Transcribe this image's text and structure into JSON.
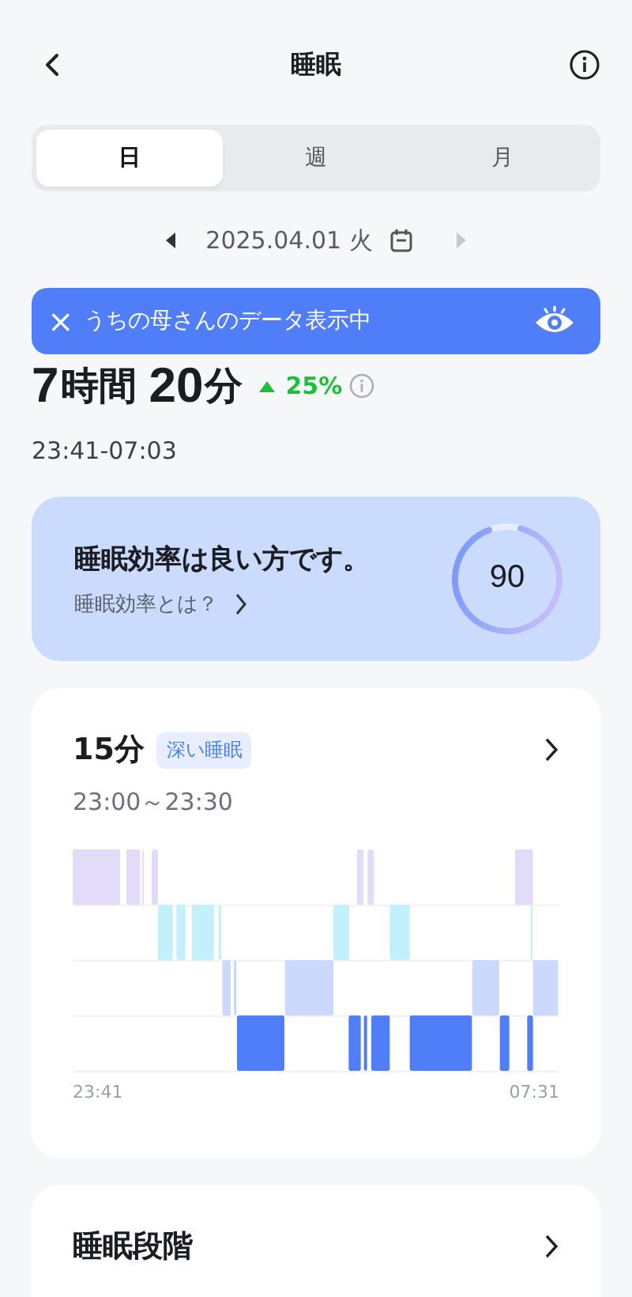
{
  "header": {
    "title": "睡眠"
  },
  "tabs": [
    {
      "label": "日",
      "selected": true
    },
    {
      "label": "週",
      "selected": false
    },
    {
      "label": "月",
      "selected": false
    }
  ],
  "date": {
    "text": "2025.04.01 火",
    "next_disabled": true
  },
  "banner": {
    "close": "×",
    "text": "うちの母さんのデータ表示中"
  },
  "duration": {
    "hours": "7",
    "hours_unit": "時間",
    "minutes": "20",
    "minutes_unit": "分",
    "change": "25%",
    "up": true
  },
  "time_range": "23:41-07:03",
  "efficiency": {
    "title": "睡眠効率は良い方です。",
    "link": "睡眠効率とは？",
    "score": "90",
    "level": 0.9
  },
  "stage_card": {
    "value": "15分",
    "tag": "深い睡眠",
    "range": "23:00～23:30",
    "axis_start": "23:41",
    "axis_end": "07:31"
  },
  "stages_section": {
    "title": "睡眠段階"
  }
}
